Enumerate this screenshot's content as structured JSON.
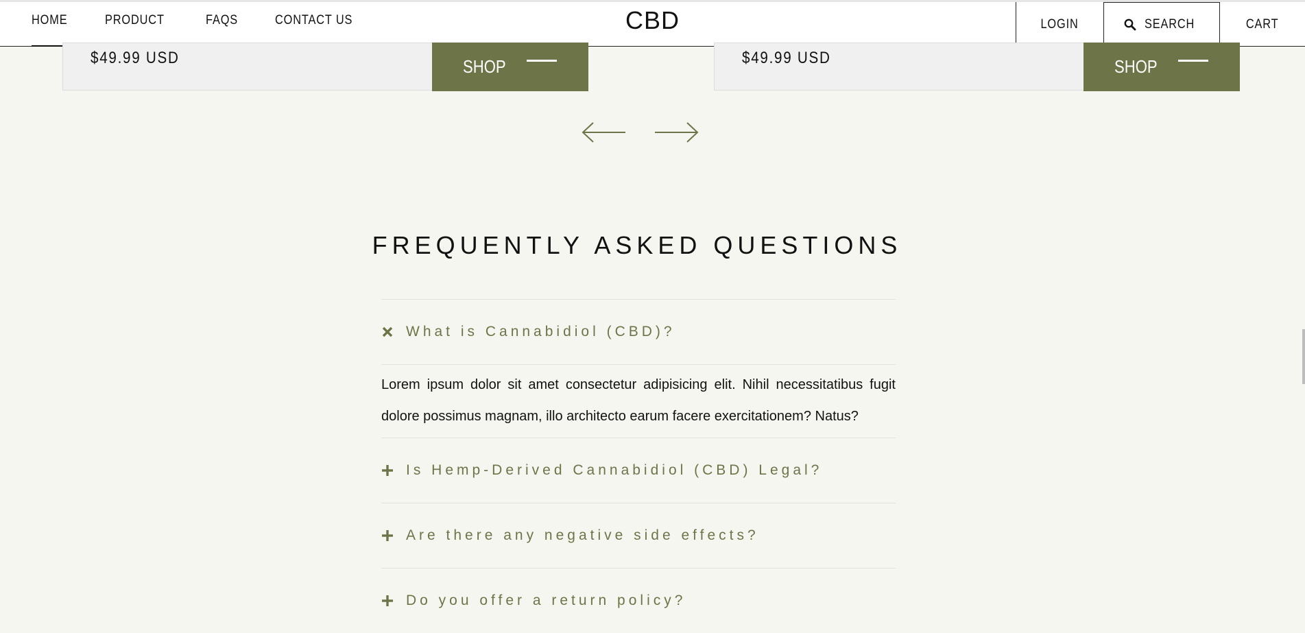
{
  "nav": {
    "left_items": [
      {
        "label": "HOME",
        "active": true
      },
      {
        "label": "PRODUCT",
        "active": false
      },
      {
        "label": "FAQS",
        "active": false
      },
      {
        "label": "CONTACT US",
        "active": false
      }
    ],
    "logo": "CBD",
    "login": "LOGIN",
    "search": "SEARCH",
    "cart": "CART",
    "search_icon": "search-icon"
  },
  "products": [
    {
      "price": "$49.99 USD",
      "shop_label": "SHOP"
    },
    {
      "price": "$49.99 USD",
      "shop_label": "SHOP"
    }
  ],
  "carousel": {
    "prev_icon": "arrow-left-icon",
    "next_icon": "arrow-right-icon"
  },
  "faq": {
    "title": "FREQUENTLY ASKED QUESTIONS",
    "items": [
      {
        "question": "What is Cannabidiol (CBD)?",
        "expanded": true,
        "icon": "close-icon",
        "answer": "Lorem ipsum dolor sit amet consectetur adipisicing elit. Nihil necessitatibus fugit dolore possimus magnam, illo architecto earum facere exercitationem? Natus?"
      },
      {
        "question": "Is Hemp-Derived Cannabidiol (CBD) Legal?",
        "expanded": false,
        "icon": "plus-icon"
      },
      {
        "question": "Are there any negative side effects?",
        "expanded": false,
        "icon": "plus-icon"
      },
      {
        "question": "Do you offer a return policy?",
        "expanded": false,
        "icon": "plus-icon"
      }
    ]
  },
  "colors": {
    "accent": "#6d7548",
    "background": "#f6f6f1",
    "card": "#f0f0f0",
    "text": "#111111"
  }
}
